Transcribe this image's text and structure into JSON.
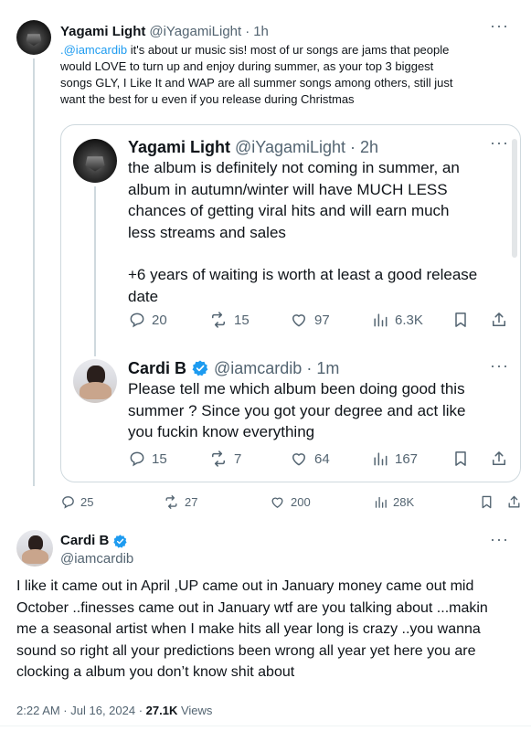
{
  "reply_tweet": {
    "author_name": "Yagami Light",
    "author_handle": "@iYagamiLight",
    "separator": "·",
    "time": "1h",
    "more_label": "···",
    "mention": ".@iamcardib",
    "text_line1": " it's about ur music sis! most of ur songs are jams that people",
    "text_line2": "would LOVE to turn up and enjoy during summer, as your top 3 biggest",
    "text_line3": "songs GLY, I Like It and WAP are all summer songs among others, still just",
    "text_line4": "want the best for u even if you release during Christmas",
    "stats": {
      "replies": "25",
      "reposts": "27",
      "likes": "200",
      "views": "28K"
    }
  },
  "quoted_thread": {
    "first": {
      "author_name": "Yagami Light",
      "author_handle": "@iYagamiLight",
      "separator": "·",
      "time": "2h",
      "more_label": "···",
      "text_line1": "the album is definitely not coming in summer, an",
      "text_line2": "album in autumn/winter will have MUCH LESS",
      "text_line3": "chances of getting viral hits and will earn much",
      "text_line4": "less streams and sales",
      "text_line5": "+6 years of waiting is worth at least a good release",
      "text_line6": "date",
      "stats": {
        "replies": "20",
        "reposts": "15",
        "likes": "97",
        "views": "6.3K"
      }
    },
    "second": {
      "author_name": "Cardi B",
      "author_handle": "@iamcardib",
      "separator": "·",
      "time": "1m",
      "more_label": "···",
      "text_line1": "Please tell me which album been doing good this",
      "text_line2": "summer ? Since you got your degree and act like",
      "text_line3": "you fuckin know everything",
      "stats": {
        "replies": "15",
        "reposts": "7",
        "likes": "64",
        "views": "167"
      }
    }
  },
  "main_tweet": {
    "author_name": "Cardi B",
    "author_handle": "@iamcardib",
    "more_label": "···",
    "text_line1": "I like it came out in April ,UP came out in January money came out mid",
    "text_line2": "October ..finesses came out in January wtf are you talking about ...makin",
    "text_line3": "me a seasonal artist when I make hits all year long is crazy ..you wanna",
    "text_line4": "sound so right all your predictions been wrong all year yet here you are",
    "text_line5": "clocking a album you don’t know shit about",
    "timestamp": "2:22 AM · Jul 16, 2024 ·",
    "views_count": "27.1K",
    "views_label": " Views"
  },
  "colors": {
    "text": "#0f1419",
    "muted": "#536471",
    "link": "#1d9bf0",
    "verified": "#1d9bf0",
    "border": "#cfd9de"
  }
}
